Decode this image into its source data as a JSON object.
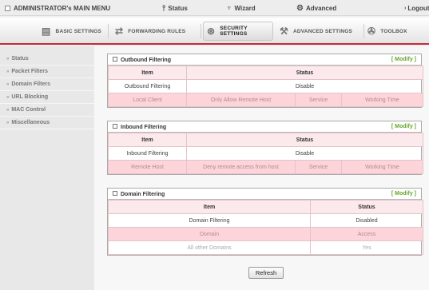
{
  "topbar": {
    "admin_label": "ADMINISTRATOR's MAIN MENU",
    "status_label": "Status",
    "wizard_label": "Wizard",
    "advanced_label": "Advanced",
    "logout_label": "Logout"
  },
  "tabs": [
    {
      "label": "BASIC SETTINGS",
      "icon": "basic-settings-icon"
    },
    {
      "label": "FORWARDING RULES",
      "icon": "forwarding-icon"
    },
    {
      "label": "SECURITY SETTINGS",
      "icon": "security-icon",
      "active": true
    },
    {
      "label": "ADVANCED SETTINGS",
      "icon": "advanced-settings-icon"
    },
    {
      "label": "TOOLBOX",
      "icon": "toolbox-icon"
    }
  ],
  "sidebar": {
    "items": [
      {
        "label": "Status"
      },
      {
        "label": "Packet Filters"
      },
      {
        "label": "Domain Filters"
      },
      {
        "label": "URL Blocking"
      },
      {
        "label": "MAC Control"
      },
      {
        "label": "Miscellaneous"
      }
    ]
  },
  "outbound": {
    "title": "Outbound Filtering",
    "modify": "[ Modify ]",
    "col_item": "Item",
    "col_status": "Status",
    "row_label": "Outbound Filtering",
    "row_value": "Disable",
    "sub": [
      "Local Client",
      "Only Allow Remote Host",
      "Service",
      "Working Time"
    ]
  },
  "inbound": {
    "title": "Inbound Filtering",
    "modify": "[ Modify ]",
    "col_item": "Item",
    "col_status": "Status",
    "row_label": "Inbound Filtering",
    "row_value": "Disable",
    "sub": [
      "Remote Host",
      "Deny remote access from host",
      "Service",
      "Working Time"
    ]
  },
  "domain": {
    "title": "Domain Filtering",
    "modify": "[ Modify ]",
    "col_item": "Item",
    "col_status": "Status",
    "row_label": "Domain Filtering",
    "row_value": "Disabled",
    "sub": [
      "Domain",
      "Access"
    ],
    "rows": [
      {
        "domain": "All other Domains",
        "access": "Yes"
      }
    ]
  },
  "refresh_label": "Refresh",
  "colors": {
    "accent": "#c52a37",
    "modify": "#6aa52f",
    "header_bg": "#fce9ec",
    "sub_bg": "#fcd4da"
  }
}
